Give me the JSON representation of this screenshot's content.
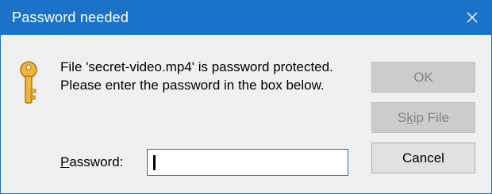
{
  "window": {
    "title": "Password needed",
    "accent_color": "#1a73c9",
    "close_icon": "close-icon"
  },
  "message": {
    "icon": "key-icon",
    "text": "File 'secret-video.mp4' is password protected.  Please enter the password in the box below."
  },
  "password": {
    "label_access_key": "P",
    "label_rest": "assword:",
    "value": ""
  },
  "buttons": {
    "ok": {
      "label": "OK",
      "enabled": false
    },
    "skip": {
      "label_pre": "S",
      "label_access_key": "k",
      "label_post": "ip File",
      "enabled": false
    },
    "cancel": {
      "label": "Cancel",
      "enabled": true
    }
  }
}
